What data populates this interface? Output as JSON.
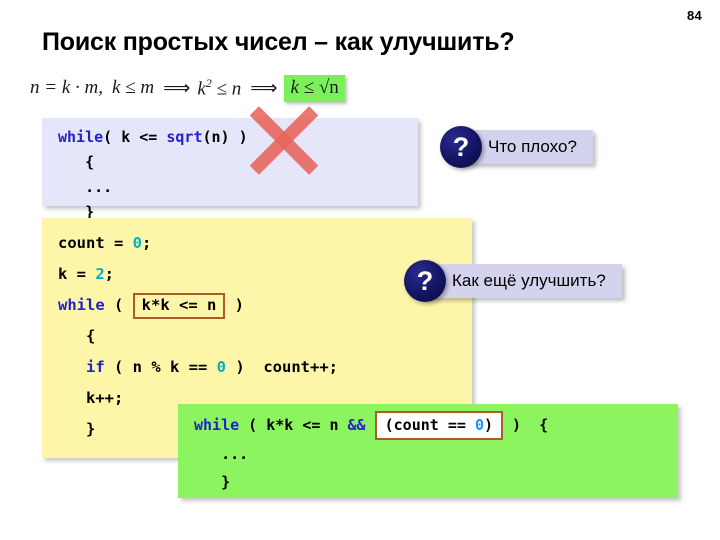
{
  "slide": {
    "page_number": "84",
    "title": "Поиск простых чисел – как улучшить?"
  },
  "formula": {
    "part1": "n = k · m,",
    "part2": "k ≤ m",
    "arrow1": "⟹",
    "part3_base": "k",
    "part3_exp": "2",
    "part3_rest": "≤ n",
    "arrow2": "⟹",
    "highlight_prefix": "k ≤ ",
    "highlight_radical": "√n",
    "highlight_color": "#7cf05a"
  },
  "code_lavender": {
    "background": "#e6e6fa",
    "lines": [
      {
        "parts": [
          {
            "t": "while",
            "c": "kw"
          },
          {
            "t": "( k <= ",
            "c": ""
          },
          {
            "t": "sqrt",
            "c": "kw"
          },
          {
            "t": "(n) )",
            "c": ""
          }
        ]
      },
      {
        "parts": [
          {
            "t": "   {",
            "c": ""
          }
        ]
      },
      {
        "parts": [
          {
            "t": "   ...",
            "c": ""
          }
        ]
      },
      {
        "parts": [
          {
            "t": "   }",
            "c": ""
          }
        ]
      }
    ],
    "annotation": "red-cross-over-sqrt"
  },
  "code_yellow": {
    "background": "#fdf6a8",
    "lines": [
      {
        "parts": [
          {
            "t": "count = ",
            "c": ""
          },
          {
            "t": "0",
            "c": "num"
          },
          {
            "t": ";",
            "c": ""
          }
        ]
      },
      {
        "parts": [
          {
            "t": "k = ",
            "c": ""
          },
          {
            "t": "2",
            "c": "num"
          },
          {
            "t": ";",
            "c": ""
          }
        ]
      },
      {
        "parts": [
          {
            "t": "while",
            "c": "kw"
          },
          {
            "t": " ( ",
            "c": ""
          },
          {
            "t": "k*k <= n",
            "c": "inbox"
          },
          {
            "t": " )",
            "c": ""
          }
        ]
      },
      {
        "parts": [
          {
            "t": "   {",
            "c": ""
          }
        ]
      },
      {
        "parts": [
          {
            "t": "   ",
            "c": ""
          },
          {
            "t": "if",
            "c": "kw"
          },
          {
            "t": " ( n % k == ",
            "c": ""
          },
          {
            "t": "0",
            "c": "num"
          },
          {
            "t": " )  count++;",
            "c": ""
          }
        ]
      },
      {
        "parts": [
          {
            "t": "   k++;",
            "c": ""
          }
        ]
      },
      {
        "parts": [
          {
            "t": "   }",
            "c": ""
          }
        ]
      }
    ]
  },
  "code_green": {
    "background": "#8cf45e",
    "lines": [
      {
        "parts": [
          {
            "t": "while",
            "c": "kw"
          },
          {
            "t": " ( k*k <= n ",
            "c": ""
          },
          {
            "t": "&&",
            "c": "kw"
          },
          {
            "t": " ",
            "c": ""
          },
          {
            "t": "(count == 0)",
            "c": "inbox-white"
          },
          {
            "t": " )  {",
            "c": ""
          }
        ]
      },
      {
        "parts": [
          {
            "t": "   ...",
            "c": ""
          }
        ]
      },
      {
        "parts": [
          {
            "t": "   }",
            "c": ""
          }
        ]
      }
    ]
  },
  "callouts": [
    {
      "symbol": "?",
      "text": "Что плохо?"
    },
    {
      "symbol": "?",
      "text": "Как ещё улучшить?"
    }
  ],
  "colors": {
    "keyword": "#2222cc",
    "number_teal": "#00b0c8",
    "number_blue": "#1e90ff",
    "box_border": "#b05a28",
    "bubble": "#d3d3ee",
    "bubble_circle": "#12125e",
    "cross": "#e8645c"
  }
}
